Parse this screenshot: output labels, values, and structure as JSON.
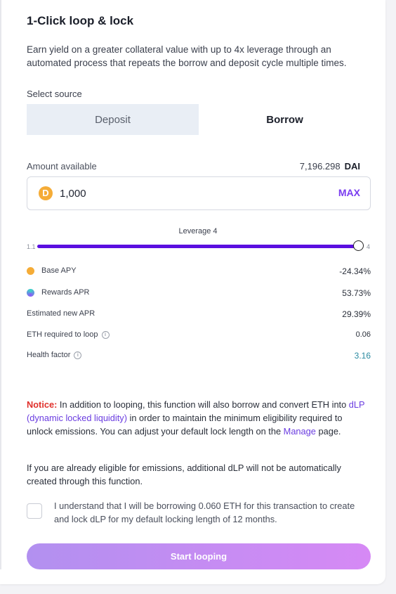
{
  "title": "1-Click loop & lock",
  "description": "Earn yield on a greater collateral value with up to 4x leverage through an automated process that repeats the borrow and deposit cycle multiple times.",
  "source": {
    "label": "Select source",
    "tabs": [
      {
        "label": "Deposit",
        "active": false
      },
      {
        "label": "Borrow",
        "active": true
      }
    ]
  },
  "amount": {
    "label": "Amount available",
    "available_value": "7,196.298",
    "token": "DAI",
    "input_value": "1,000",
    "max_label": "MAX",
    "coin_glyph": "D"
  },
  "leverage": {
    "label": "Leverage",
    "value": "4",
    "min": "1.1",
    "max": "4",
    "fill_fraction": 1.0
  },
  "stats": [
    {
      "label": "Base APY",
      "value": "-24.34%",
      "icon": "dai-icon"
    },
    {
      "label": "Rewards APR",
      "value": "53.73%",
      "icon": "rewards-icon"
    },
    {
      "label": "Estimated new APR",
      "value": "29.39%"
    },
    {
      "label": "ETH required to loop",
      "value": "0.06",
      "info": "i"
    },
    {
      "label": "Health factor",
      "value": "3.16",
      "info": "i"
    }
  ],
  "notice": {
    "prefix": "Notice:",
    "text1": " In addition to looping, this function will also borrow and convert ETH into ",
    "link1": "dLP (dynamic locked liquidity)",
    "text2": " in order to maintain the minimum eligibility required to unlock emissions. You can adjust your default lock length on the ",
    "link2": "Manage",
    "text3": " page."
  },
  "note2": "If you are already eligible for emissions, additional dLP will not be automatically created through this function.",
  "agreement": "I understand that I will be borrowing 0.060 ETH for this transaction to create and lock dLP for my default locking length of 12 months.",
  "start_button": "Start looping",
  "colors": {
    "accent": "#5a0fe0",
    "max": "#7a3cf0",
    "notice": "#e0302b",
    "health": "#2a8aa0"
  }
}
